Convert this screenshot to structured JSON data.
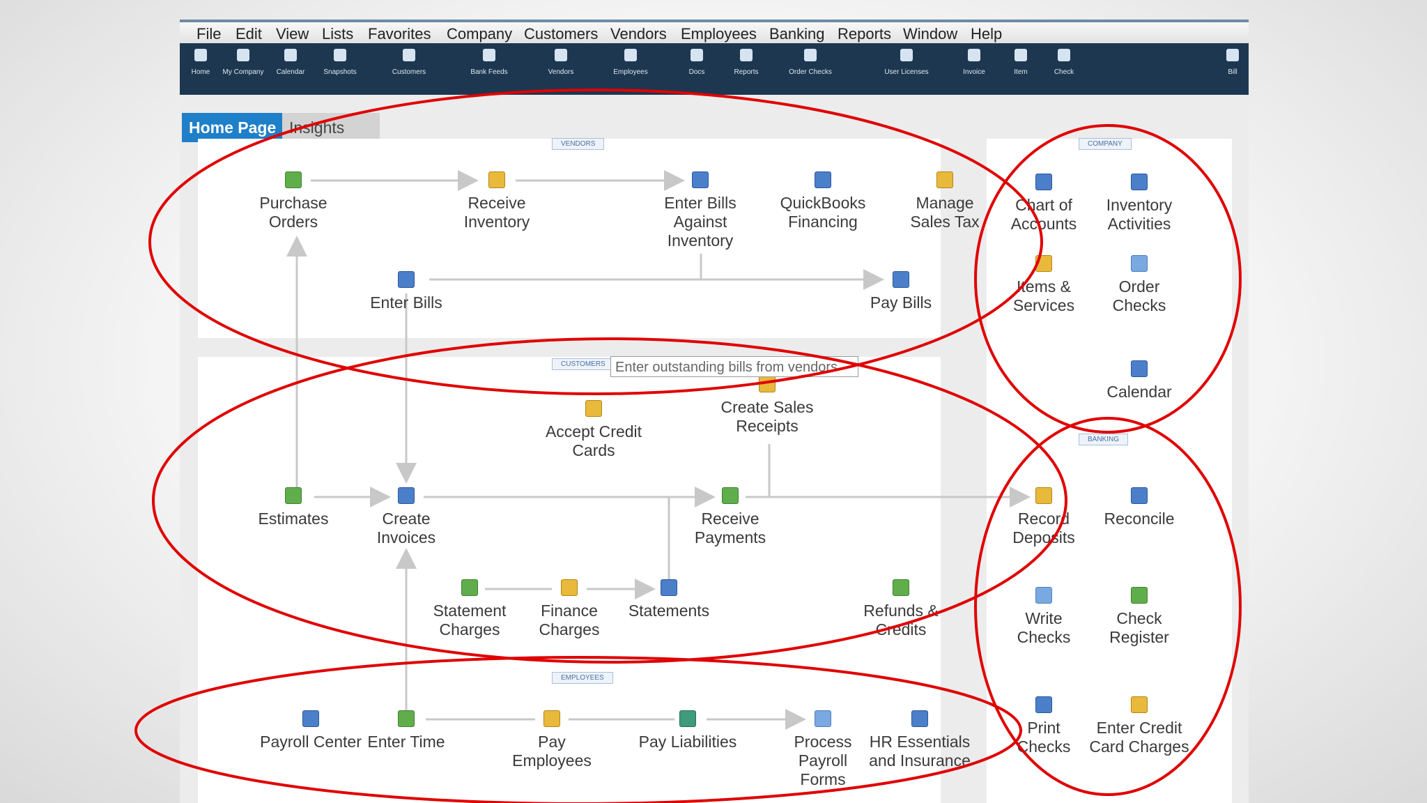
{
  "menu": [
    "File",
    "Edit",
    "View",
    "Lists",
    "Favorites",
    "Company",
    "Customers",
    "Vendors",
    "Employees",
    "Banking",
    "Reports",
    "Window",
    "Help"
  ],
  "toolbar": [
    "Home",
    "My Company",
    "Calendar",
    "Snapshots",
    "Customers",
    "Bank Feeds",
    "Vendors",
    "Employees",
    "Docs",
    "Reports",
    "Order Checks",
    "User Licenses",
    "Invoice",
    "Item",
    "Check",
    "Bill"
  ],
  "tabs": {
    "home": "Home Page",
    "insights": "Insights"
  },
  "sections": {
    "vendors": "VENDORS",
    "customers": "CUSTOMERS",
    "employees": "EMPLOYEES",
    "company": "COMPANY",
    "banking": "BANKING"
  },
  "vendors": {
    "purchase_orders": "Purchase Orders",
    "receive_inventory": "Receive Inventory",
    "enter_bills_against_inventory": "Enter Bills Against Inventory",
    "quickbooks_financing": "QuickBooks Financing",
    "manage_sales_tax": "Manage Sales Tax",
    "enter_bills": "Enter Bills",
    "pay_bills": "Pay Bills"
  },
  "tooltip": "Enter outstanding bills from vendors",
  "customers": {
    "accept_credit_cards": "Accept Credit Cards",
    "create_sales_receipts": "Create Sales Receipts",
    "estimates": "Estimates",
    "create_invoices": "Create Invoices",
    "receive_payments": "Receive Payments",
    "statement_charges": "Statement Charges",
    "finance_charges": "Finance Charges",
    "statements": "Statements",
    "refunds_credits": "Refunds & Credits"
  },
  "employees": {
    "payroll_center": "Payroll Center",
    "enter_time": "Enter Time",
    "pay_employees": "Pay Employees",
    "pay_liabilities": "Pay Liabilities",
    "process_payroll_forms": "Process Payroll Forms",
    "hr_essentials": "HR Essentials and Insurance"
  },
  "company": {
    "chart_of_accounts": "Chart of Accounts",
    "inventory_activities": "Inventory Activities",
    "items_services": "Items & Services",
    "order_checks": "Order Checks",
    "calendar": "Calendar"
  },
  "banking": {
    "record_deposits": "Record Deposits",
    "reconcile": "Reconcile",
    "write_checks": "Write Checks",
    "check_register": "Check Register",
    "print_checks": "Print Checks",
    "enter_credit_card_charges": "Enter Credit Card Charges"
  },
  "colors": {
    "toolbar_bg": "#1d3750",
    "tab_active": "#1f7fc8",
    "annotation": "#e00000",
    "flow_line": "#c8c8c8"
  }
}
